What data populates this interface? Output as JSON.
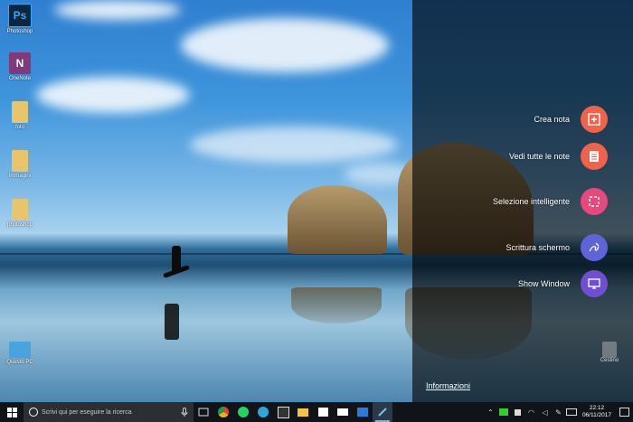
{
  "desktop": {
    "icons": [
      {
        "label": "Photoshop",
        "glyph": "Ps",
        "color": "#0b2640",
        "glyph_color": "#31a8ff"
      },
      {
        "label": "OneNote",
        "glyph": "N",
        "color": "#80397b",
        "glyph_color": "#ffffff"
      },
      {
        "label": "foto",
        "glyph": "",
        "color": "#e8c46a",
        "glyph_color": "#ffffff"
      },
      {
        "label": "immagini",
        "glyph": "",
        "color": "#e8c46a",
        "glyph_color": "#ffffff"
      },
      {
        "label": "photoshop",
        "glyph": "",
        "color": "#e8c46a",
        "glyph_color": "#ffffff"
      },
      {
        "label": "Questo PC",
        "glyph": "",
        "color": "#4aa3df",
        "glyph_color": "#ffffff"
      }
    ],
    "recycle_bin": {
      "label": "Cestino"
    }
  },
  "quick_menu": {
    "items": [
      {
        "label": "Crea nota",
        "color": "#f0634a",
        "icon": "plus-note-icon"
      },
      {
        "label": "Vedi tutte le note",
        "color": "#f0634a",
        "icon": "notes-list-icon"
      },
      {
        "label": "Selezione intelligente",
        "color": "#e8497c",
        "icon": "smart-select-icon"
      },
      {
        "label": "Scrittura schermo",
        "color": "#5f63d8",
        "icon": "pen-write-icon"
      },
      {
        "label": "Show Window",
        "color": "#6f4fd0",
        "icon": "window-icon"
      }
    ],
    "info_link": "Informazioni"
  },
  "taskbar": {
    "search_placeholder": "Scrivi qui per eseguire la ricerca",
    "apps": [
      "task-view",
      "chrome",
      "whatsapp",
      "telegram",
      "calendar",
      "file-explorer",
      "store",
      "mail",
      "photos",
      "pen-app"
    ],
    "time": "22:12",
    "date": "06/11/2017"
  }
}
